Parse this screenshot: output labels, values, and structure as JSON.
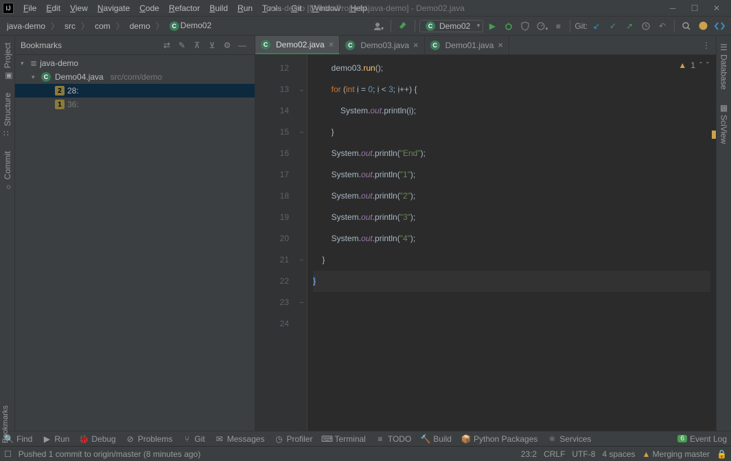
{
  "title": "java-demo [D:\\IdeaProjects\\java-demo] - Demo02.java",
  "menu": [
    "File",
    "Edit",
    "View",
    "Navigate",
    "Code",
    "Refactor",
    "Build",
    "Run",
    "Tools",
    "Git",
    "Window",
    "Help"
  ],
  "breadcrumb": [
    "java-demo",
    "src",
    "com",
    "demo",
    "Demo02"
  ],
  "run_config": "Demo02",
  "git_label": "Git:",
  "bookmarks": {
    "title": "Bookmarks",
    "root": "java-demo",
    "file": "Demo04.java",
    "file_path": "src/com/demo",
    "items": [
      {
        "num": "2",
        "label": "28:"
      },
      {
        "num": "1",
        "label": "36:"
      }
    ]
  },
  "tabs": [
    "Demo02.java",
    "Demo03.java",
    "Demo01.java"
  ],
  "active_tab": 0,
  "editor": {
    "lines": [
      12,
      13,
      14,
      15,
      16,
      17,
      18,
      19,
      20,
      21,
      22,
      23,
      24
    ],
    "code": [
      {
        "indent": "        ",
        "tokens": [
          {
            "t": "demo03.",
            "c": "plain"
          },
          {
            "t": "run",
            "c": "fn"
          },
          {
            "t": "();",
            "c": "plain"
          }
        ]
      },
      {
        "indent": "        ",
        "tokens": [
          {
            "t": "for ",
            "c": "kw"
          },
          {
            "t": "(",
            "c": "plain"
          },
          {
            "t": "int ",
            "c": "kw"
          },
          {
            "t": "i",
            "c": "var-u"
          },
          {
            "t": " = ",
            "c": "plain"
          },
          {
            "t": "0",
            "c": "num"
          },
          {
            "t": "; ",
            "c": "plain"
          },
          {
            "t": "i",
            "c": "var-u"
          },
          {
            "t": " < ",
            "c": "plain"
          },
          {
            "t": "3",
            "c": "num"
          },
          {
            "t": "; ",
            "c": "plain"
          },
          {
            "t": "i",
            "c": "var-u"
          },
          {
            "t": "++) {",
            "c": "plain"
          }
        ]
      },
      {
        "indent": "            ",
        "tokens": [
          {
            "t": "System.",
            "c": "plain"
          },
          {
            "t": "out",
            "c": "field"
          },
          {
            "t": ".println(",
            "c": "plain"
          },
          {
            "t": "i",
            "c": "var-u"
          },
          {
            "t": ");",
            "c": "plain"
          }
        ]
      },
      {
        "indent": "        ",
        "tokens": [
          {
            "t": "}",
            "c": "plain"
          }
        ]
      },
      {
        "indent": "        ",
        "tokens": [
          {
            "t": "System.",
            "c": "plain"
          },
          {
            "t": "out",
            "c": "field"
          },
          {
            "t": ".println(",
            "c": "plain"
          },
          {
            "t": "\"End\"",
            "c": "str"
          },
          {
            "t": ");",
            "c": "plain"
          }
        ]
      },
      {
        "indent": "        ",
        "tokens": [
          {
            "t": "System.",
            "c": "plain"
          },
          {
            "t": "out",
            "c": "field"
          },
          {
            "t": ".println(",
            "c": "plain"
          },
          {
            "t": "\"1\"",
            "c": "str"
          },
          {
            "t": ");",
            "c": "plain"
          }
        ]
      },
      {
        "indent": "        ",
        "tokens": [
          {
            "t": "System.",
            "c": "plain"
          },
          {
            "t": "out",
            "c": "field"
          },
          {
            "t": ".println(",
            "c": "plain"
          },
          {
            "t": "\"2\"",
            "c": "str"
          },
          {
            "t": ");",
            "c": "plain"
          }
        ]
      },
      {
        "indent": "        ",
        "tokens": [
          {
            "t": "System.",
            "c": "plain"
          },
          {
            "t": "out",
            "c": "field"
          },
          {
            "t": ".println(",
            "c": "plain"
          },
          {
            "t": "\"3\"",
            "c": "str"
          },
          {
            "t": ");",
            "c": "plain"
          }
        ]
      },
      {
        "indent": "        ",
        "tokens": [
          {
            "t": "System.",
            "c": "plain"
          },
          {
            "t": "out",
            "c": "field"
          },
          {
            "t": ".println(",
            "c": "plain"
          },
          {
            "t": "\"4\"",
            "c": "str"
          },
          {
            "t": ");",
            "c": "plain"
          }
        ]
      },
      {
        "indent": "    ",
        "tokens": [
          {
            "t": "}",
            "c": "plain"
          }
        ]
      },
      {
        "indent": "",
        "tokens": []
      },
      {
        "indent": "",
        "tokens": [
          {
            "t": "}",
            "c": "plain",
            "caret": true
          }
        ]
      },
      {
        "indent": "",
        "tokens": []
      }
    ],
    "warnings": "1"
  },
  "left_tabs": [
    "Project",
    "Structure",
    "Commit"
  ],
  "left_bottom_tab": "Bookmarks",
  "right_tabs": [
    "Database",
    "SciView"
  ],
  "tool_windows": [
    "Find",
    "Run",
    "Debug",
    "Problems",
    "Git",
    "Messages",
    "Profiler",
    "Terminal",
    "TODO",
    "Build",
    "Python Packages",
    "Services",
    "Event Log"
  ],
  "event_log_badge": "6",
  "status": {
    "msg": "Pushed 1 commit to origin/master (8 minutes ago)",
    "pos": "23:2",
    "eol": "CRLF",
    "enc": "UTF-8",
    "indent": "4 spaces",
    "branch": "Merging master"
  }
}
